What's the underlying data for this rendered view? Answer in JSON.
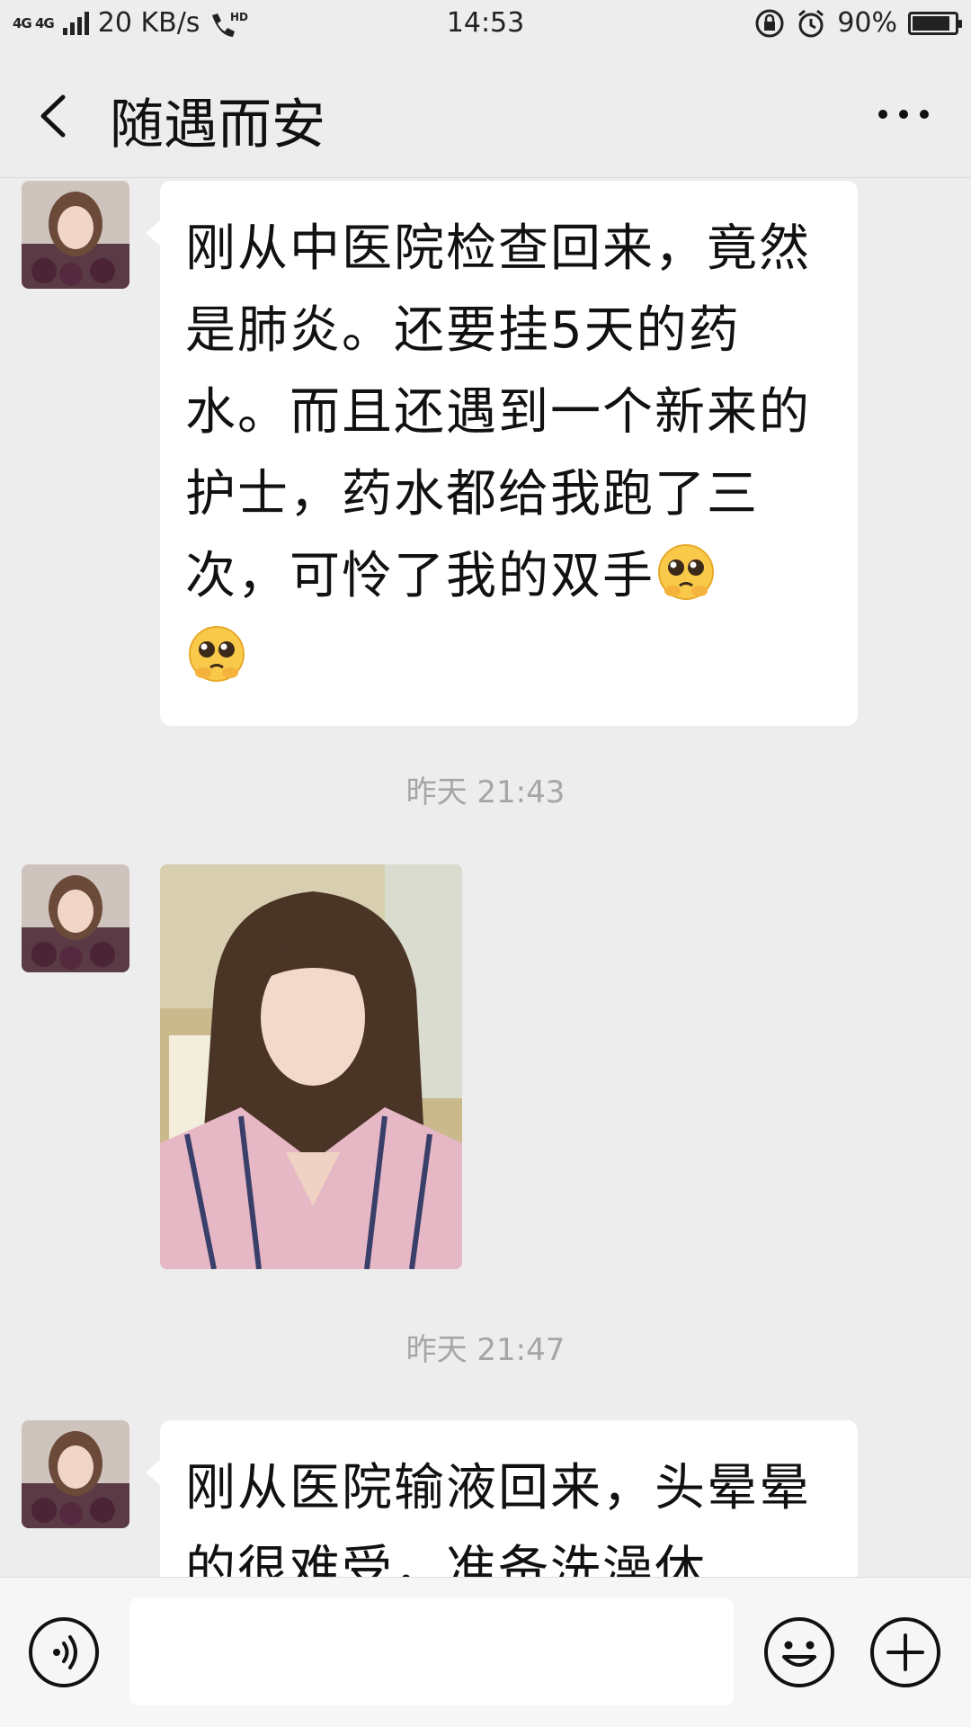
{
  "status_bar": {
    "network": "4G 4G",
    "speed": "20 KB/s",
    "hd": "HD",
    "time": "14:53",
    "battery_percent": "90%",
    "battery_level": 0.9
  },
  "header": {
    "back_icon": "chevron-left-icon",
    "title": "随遇而安",
    "more_icon": "more-dots-icon"
  },
  "messages": [
    {
      "type": "text",
      "text": "刚从中医院检查回来，竟然是肺炎。还要挂5天的药水。而且还遇到一个新来的护士，药水都给我跑了三次，可怜了我的双手",
      "emojis": [
        "pleading-face-emoji",
        "pleading-face-emoji"
      ]
    },
    {
      "type": "time",
      "text": "昨天 21:43"
    },
    {
      "type": "image",
      "content": "selfie-photo"
    },
    {
      "type": "time",
      "text": "昨天 21:47"
    },
    {
      "type": "text",
      "text": "刚从医院输液回来，头晕晕的很难受，准备洗澡休"
    }
  ],
  "input_bar": {
    "voice_icon": "voice-input-icon",
    "input_value": "",
    "emoji_icon": "emoji-face-icon",
    "plus_icon": "plus-circle-icon"
  },
  "colors": {
    "background": "#ededed",
    "bubble": "#ffffff",
    "timestamp": "#a6a6a6",
    "bottom_bar": "#f6f6f6"
  }
}
